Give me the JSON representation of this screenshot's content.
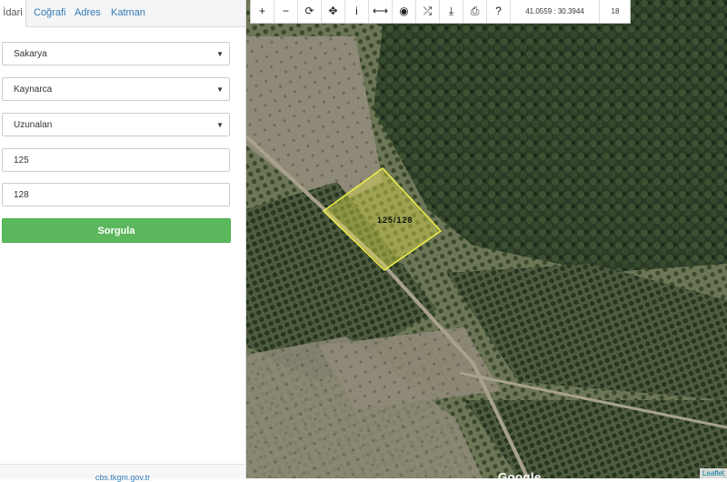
{
  "tabs": [
    "İdari",
    "Coğrafi",
    "Adres",
    "Katman"
  ],
  "form": {
    "il": "Sakarya",
    "ilce": "Kaynarca",
    "mahalle": "Uzunalan",
    "ada": "125",
    "parsel": "128",
    "button": "Sorgula"
  },
  "footer": "cbs.tkgm.gov.tr",
  "toolbar": {
    "icons": [
      "plus-icon",
      "minus-icon",
      "refresh-icon",
      "locate-icon",
      "info-icon",
      "measure-icon",
      "eye-icon",
      "shuffle-icon",
      "download-icon",
      "print-icon",
      "help-icon"
    ],
    "glyphs": [
      "+",
      "−",
      "⟳",
      "✥",
      "i",
      "⟷",
      "◉",
      "⤮",
      "⤓",
      "⎙",
      "?"
    ],
    "coordinates": "41.0559 : 30.3944",
    "zoom": "18"
  },
  "map": {
    "parcel_label": "125/128",
    "attribution": "Leaflet",
    "provider": "Google",
    "parcel_color": "#e8e84a"
  }
}
